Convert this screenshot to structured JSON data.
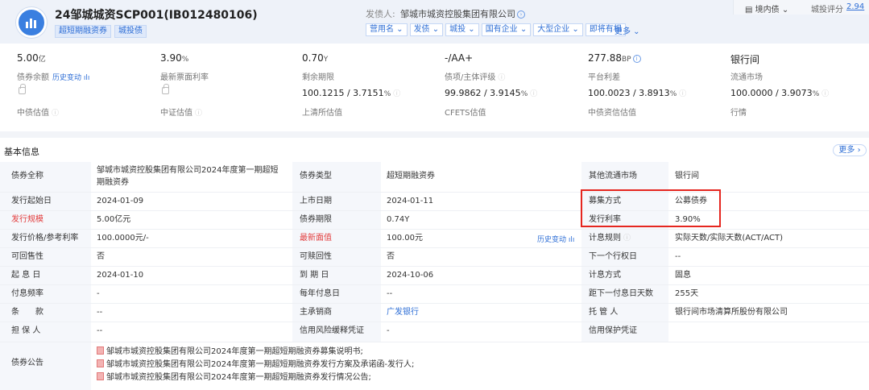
{
  "header": {
    "bond_title": "24邹城城资SCP001(IB012480106)",
    "tags": [
      "超短期融资券",
      "城投债"
    ],
    "issuer_label": "发债人:",
    "issuer_name": "邹城市城资控股集团有限公司",
    "issuer_tags": [
      "营用名",
      "发债",
      "城投",
      "国有企业",
      "大型企业",
      "即将有相"
    ],
    "more_tags": "更多",
    "domestic_rating": "境内债",
    "city_invest_score_label": "城投评分",
    "city_invest_score": "2.94"
  },
  "metrics": [
    {
      "value": "5.00",
      "unit": "亿",
      "label": "债券余额",
      "link": "历史变动",
      "sub_value": "",
      "sub_label": "中债估值"
    },
    {
      "value": "3.90",
      "unit": "%",
      "label": "最新票面利率",
      "link": "",
      "sub_value": "",
      "sub_label": "中证估值"
    },
    {
      "value": "0.70",
      "unit": "Y",
      "label": "剩余期限",
      "link": "",
      "sub_value": "100.1215 / 3.7151",
      "sub_unit": "%",
      "sub_label": "上清所估值"
    },
    {
      "value": "-/AA+",
      "unit": "",
      "label": "债项/主体评级",
      "link": "",
      "sub_value": "99.9862 / 3.9145",
      "sub_unit": "%",
      "sub_label": "CFETS估值"
    },
    {
      "value": "277.88",
      "unit": "BP",
      "label": "平台利差",
      "link": "",
      "sub_value": "100.0023 / 3.8913",
      "sub_unit": "%",
      "sub_label": "中债资信估值"
    },
    {
      "value": "银行间",
      "unit": "",
      "label": "流通市场",
      "link": "",
      "sub_value": "100.0000 / 3.9073",
      "sub_unit": "%",
      "sub_label": "行情"
    }
  ],
  "basic": {
    "title": "基本信息",
    "more": "更多",
    "col1": [
      {
        "label": "债券全称",
        "value": "邹城市城资控股集团有限公司2024年度第一期超短",
        "value2": "期融资券"
      },
      {
        "label": "发行起始日",
        "value": "2024-01-09"
      },
      {
        "label": "发行规模",
        "value": "5.00亿元",
        "red": true
      },
      {
        "label": "发行价格/参考利率",
        "value": "100.0000元/-"
      },
      {
        "label": "可回售性",
        "value": "否"
      },
      {
        "label": "起 息 日",
        "value": "2024-01-10"
      },
      {
        "label": "付息频率",
        "value": "-"
      },
      {
        "label": "条　　款",
        "value": "--"
      },
      {
        "label": "担 保 人",
        "value": "--"
      }
    ],
    "col2": [
      {
        "label": "债券类型",
        "value": "超短期融资券"
      },
      {
        "label": "上市日期",
        "value": "2024-01-11"
      },
      {
        "label": "债券期限",
        "value": "0.74Y"
      },
      {
        "label": "最新面值",
        "value": "100.00元",
        "red": true,
        "link": "历史变动"
      },
      {
        "label": "可赎回性",
        "value": "否"
      },
      {
        "label": "到 期 日",
        "value": "2024-10-06"
      },
      {
        "label": "每年付息日",
        "value": "--"
      },
      {
        "label": "主承销商",
        "value": "广发银行",
        "blue": true
      },
      {
        "label": "信用风险缓释凭证",
        "value": "-"
      }
    ],
    "col3": [
      {
        "label": "其他流通市场",
        "value": "银行间"
      },
      {
        "label": "募集方式",
        "value": "公募债券"
      },
      {
        "label": "发行利率",
        "value": "3.90%"
      },
      {
        "label": "计息规则",
        "value": "实际天数/实际天数(ACT/ACT)"
      },
      {
        "label": "下一个行权日",
        "value": "--"
      },
      {
        "label": "计息方式",
        "value": "固息"
      },
      {
        "label": "距下一付息日天数",
        "value": "255天"
      },
      {
        "label": "托 管 人",
        "value": "银行间市场清算所股份有限公司"
      },
      {
        "label": "信用保护凭证",
        "value": ""
      }
    ],
    "announcement_label": "债券公告",
    "announcements": [
      "邹城市城资控股集团有限公司2024年度第一期超短期融资券募集说明书;",
      "邹城市城资控股集团有限公司2024年度第一期超短期融资券发行方案及承诺函-发行人;",
      "邹城市城资控股集团有限公司2024年度第一期超短期融资券发行情况公告;"
    ]
  },
  "colors": {
    "accent": "#2f6fd6",
    "highlight_box": "#e5261f",
    "red_label": "#e23c3c"
  }
}
